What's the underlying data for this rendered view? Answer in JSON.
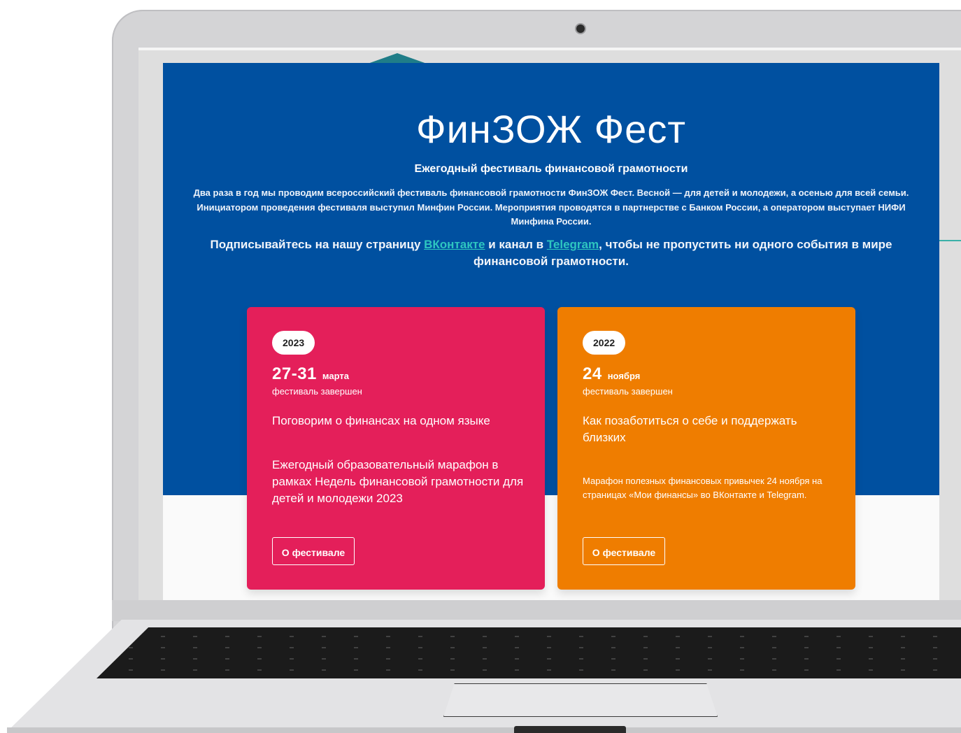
{
  "hero": {
    "title": "ФинЗОЖ Фест",
    "subtitle": "Ежегодный фестиваль финансовой грамотности",
    "description": "Два раза в год мы проводим всероссийский фестиваль финансовой грамотности ФинЗОЖ Фест. Весной — для детей и молодежи, а осенью для всей семьи. Инициатором проведения фестиваля выступил Минфин России. Мероприятия проводятся в партнерстве с Банком России, а оператором выступает НИФИ Минфина России.",
    "subscribe_before": "Подписывайтесь на нашу страницу ",
    "vk_link": "ВКонтакте",
    "subscribe_middle": " и канал в ",
    "telegram_link": "Telegram",
    "subscribe_after": ", чтобы не пропустить ни одного события в мире финансовой грамотности."
  },
  "cards": [
    {
      "year": "2023",
      "days": "27-31",
      "month": "марта",
      "status": "фестиваль завершен",
      "title": "Поговорим о финансах на одном языке",
      "description": "Ежегодный образовательный марафон в рамках Недель финансовой грамотности для детей и молодежи 2023",
      "button": "О фестивале",
      "color": "#e41f5a"
    },
    {
      "year": "2022",
      "days": "24",
      "month": "ноября",
      "status": "фестиваль завершен",
      "title": "Как позаботиться о себе и поддержать близких",
      "description": "Марафон полезных финансовых привычек 24 ноября на страницах «Мои финансы» во ВКонтакте и Telegram.",
      "button": "О фестивале",
      "color": "#ef7d00"
    }
  ],
  "colors": {
    "hero_background": "#0050a0",
    "link": "#2ec6c0"
  }
}
